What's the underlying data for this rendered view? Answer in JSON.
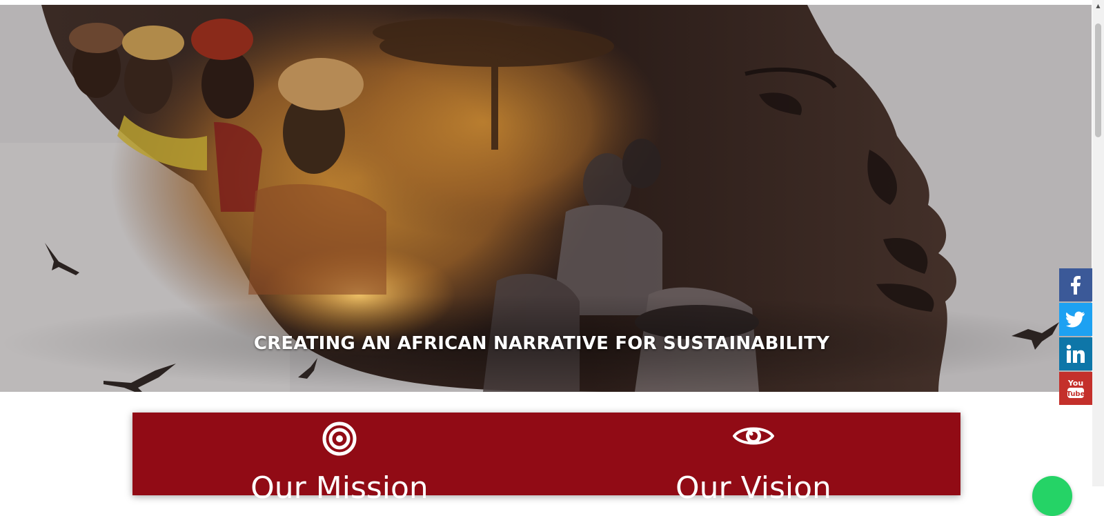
{
  "hero": {
    "title": "CREATING AN AFRICAN NARRATIVE FOR SUSTAINABILITY"
  },
  "social": [
    {
      "name": "facebook",
      "icon": "facebook-icon",
      "color": "#3b5998"
    },
    {
      "name": "twitter",
      "icon": "twitter-icon",
      "color": "#1da1f2"
    },
    {
      "name": "linkedin",
      "icon": "linkedin-icon",
      "color": "#0e76a8"
    },
    {
      "name": "youtube",
      "icon": "youtube-icon",
      "color": "#c4302b"
    }
  ],
  "mission": {
    "heading": "Our Mission",
    "icon": "target-icon"
  },
  "vision": {
    "heading": "Our Vision",
    "icon": "eye-icon"
  },
  "colors": {
    "accent": "#910b15",
    "hero_bg": "#b3b0b1"
  },
  "chat": {
    "icon": "chat-icon",
    "color": "#25d366"
  }
}
